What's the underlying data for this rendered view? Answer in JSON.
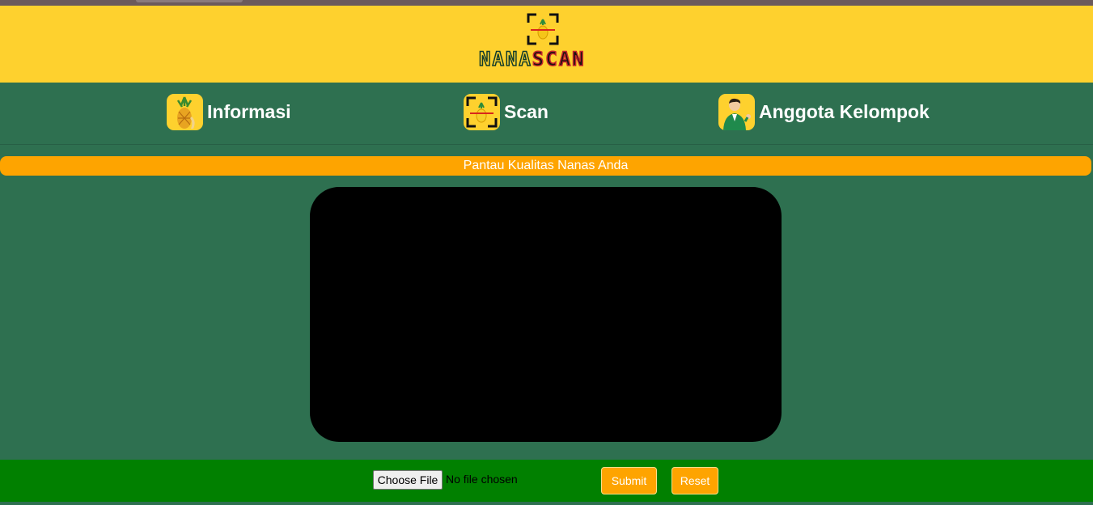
{
  "header": {
    "logo": {
      "word_1": "NANA",
      "word_2": "SCAN"
    }
  },
  "nav": {
    "items": [
      {
        "label": "Informasi",
        "icon": "pineapple-icon"
      },
      {
        "label": "Scan",
        "icon": "scan-frame-icon"
      },
      {
        "label": "Anggota Kelompok",
        "icon": "person-avatar-icon"
      }
    ]
  },
  "banner": {
    "text": "Pantau Kualitas Nanas Anda"
  },
  "upload": {
    "choose_file_label": "Choose File",
    "status_text": "No file chosen"
  },
  "actions": {
    "submit_label": "Submit",
    "reset_label": "Reset"
  },
  "colors": {
    "header_bg": "#fed12e",
    "page_bg": "#2e7050",
    "accent": "#fea400",
    "footer_bg": "#018000",
    "video_bg": "#000000"
  }
}
